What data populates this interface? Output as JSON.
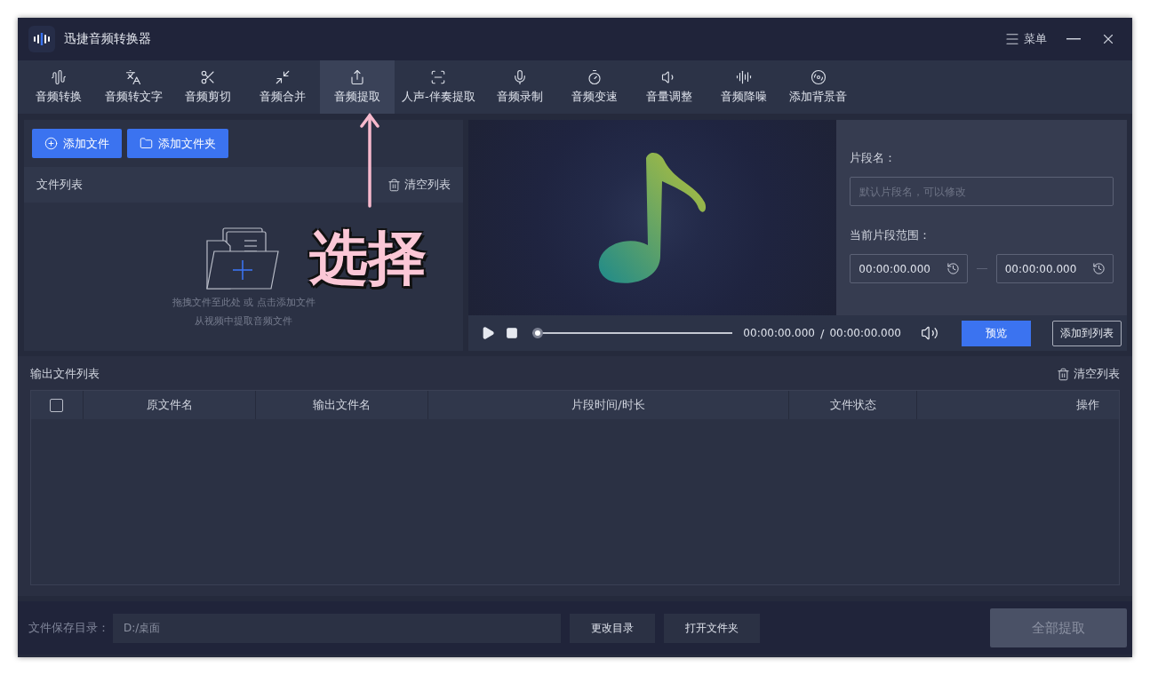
{
  "window": {
    "title": "迅捷音频转换器",
    "menu_label": "菜单"
  },
  "toolbar": [
    {
      "label": "音频转换",
      "selected": false
    },
    {
      "label": "音频转文字",
      "selected": false
    },
    {
      "label": "音频剪切",
      "selected": false
    },
    {
      "label": "音频合并",
      "selected": false
    },
    {
      "label": "音频提取",
      "selected": true
    },
    {
      "label": "人声-伴奏提取",
      "selected": false
    },
    {
      "label": "音频录制",
      "selected": false
    },
    {
      "label": "音频变速",
      "selected": false
    },
    {
      "label": "音量调整",
      "selected": false
    },
    {
      "label": "音频降噪",
      "selected": false
    },
    {
      "label": "添加背景音",
      "selected": false
    }
  ],
  "left_panel": {
    "buttons": [
      "添加文件",
      "添加文件夹"
    ],
    "list_title": "文件列表",
    "clear_label": "清空列表",
    "drop_hint": "拖拽文件至此处 或 点击添加文件",
    "sub_hint": "从视频中提取音频文件"
  },
  "annotation": {
    "text": "选择"
  },
  "player": {
    "current_time": "00:00:00.000",
    "separator": "/",
    "total_time": "00:00:00.000",
    "level": 0,
    "preview_button": "预览",
    "add_button": "添加到列表"
  },
  "segment": {
    "name_label": "片段名：",
    "name_placeholder": "默认片段名，可以修改",
    "range_label": "当前片段范围：",
    "start": "00:00:00.000",
    "end": "00:00:00.000"
  },
  "output": {
    "title": "输出文件列表",
    "clear_label": "清空列表",
    "select_all_checked": false,
    "columns": [
      "原文件名",
      "输出文件名",
      "片段时间/时长",
      "文件状态",
      "操作"
    ]
  },
  "footer": {
    "label": "文件保存目录：",
    "path": "D:/桌面",
    "buttons": [
      "更改目录",
      "打开文件夹"
    ],
    "extract_button": "全部提取",
    "extract_disabled": true
  }
}
